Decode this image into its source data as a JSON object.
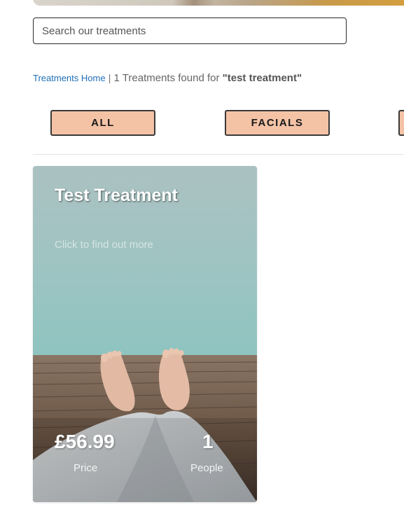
{
  "search": {
    "placeholder": "Search our treatments",
    "value": ""
  },
  "breadcrumb": {
    "home_label": "Treatments Home",
    "separator": "|",
    "results_text": "1 Treatments found for",
    "query": "\"test treatment\""
  },
  "filters": [
    {
      "label": "ALL"
    },
    {
      "label": "FACIALS"
    },
    {
      "label": ""
    }
  ],
  "card": {
    "title": "Test Treatment",
    "cta": "Click to find out more",
    "price": "£56.99",
    "price_label": "Price",
    "people": "1",
    "people_label": "People",
    "image": "feet-on-wooden-pier-by-sea"
  },
  "colors": {
    "filter_bg": "#f4c3a6",
    "link": "#1f6fb8",
    "sky": "#a9c6c4",
    "pier": "#6f5a48"
  }
}
